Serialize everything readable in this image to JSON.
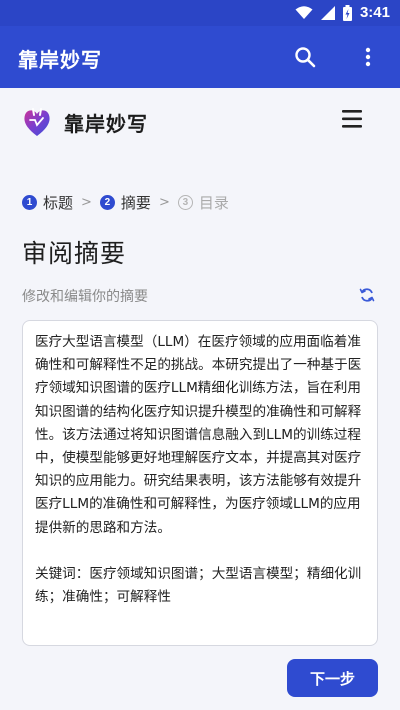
{
  "status_bar": {
    "time": "3:41",
    "icons": [
      "wifi-icon",
      "signal-icon",
      "battery-icon"
    ]
  },
  "app_bar": {
    "title": "靠岸妙写",
    "icons": [
      "search-icon",
      "more-vert-icon"
    ]
  },
  "site_header": {
    "name": "靠岸妙写",
    "icons": [
      "logo-icon",
      "hamburger-menu-icon"
    ]
  },
  "steps": [
    {
      "num": "1",
      "label": "标题",
      "state": "active"
    },
    {
      "num": "2",
      "label": "摘要",
      "state": "active"
    },
    {
      "num": "3",
      "label": "目录",
      "state": "inactive"
    }
  ],
  "page": {
    "title": "审阅摘要",
    "subtitle": "修改和编辑你的摘要",
    "refresh_icon": "refresh-icon"
  },
  "abstract": {
    "text": "医疗大型语言模型（LLM）在医疗领域的应用面临着准确性和可解释性不足的挑战。本研究提出了一种基于医疗领域知识图谱的医疗LLM精细化训练方法，旨在利用知识图谱的结构化医疗知识提升模型的准确性和可解释性。该方法通过将知识图谱信息融入到LLM的训练过程中，使模型能够更好地理解医疗文本，并提高其对医疗知识的应用能力。研究结果表明，该方法能够有效提升医疗LLM的准确性和可解释性，为医疗领域LLM的应用提供新的思路和方法。\n\n关键词：医疗领域知识图谱；大型语言模型；精细化训练；准确性；可解释性"
  },
  "next_button": {
    "label": "下一步"
  },
  "colors": {
    "primary": "#2f4bd0",
    "status_bar": "#2b45c6",
    "background": "#f4f5fa"
  }
}
